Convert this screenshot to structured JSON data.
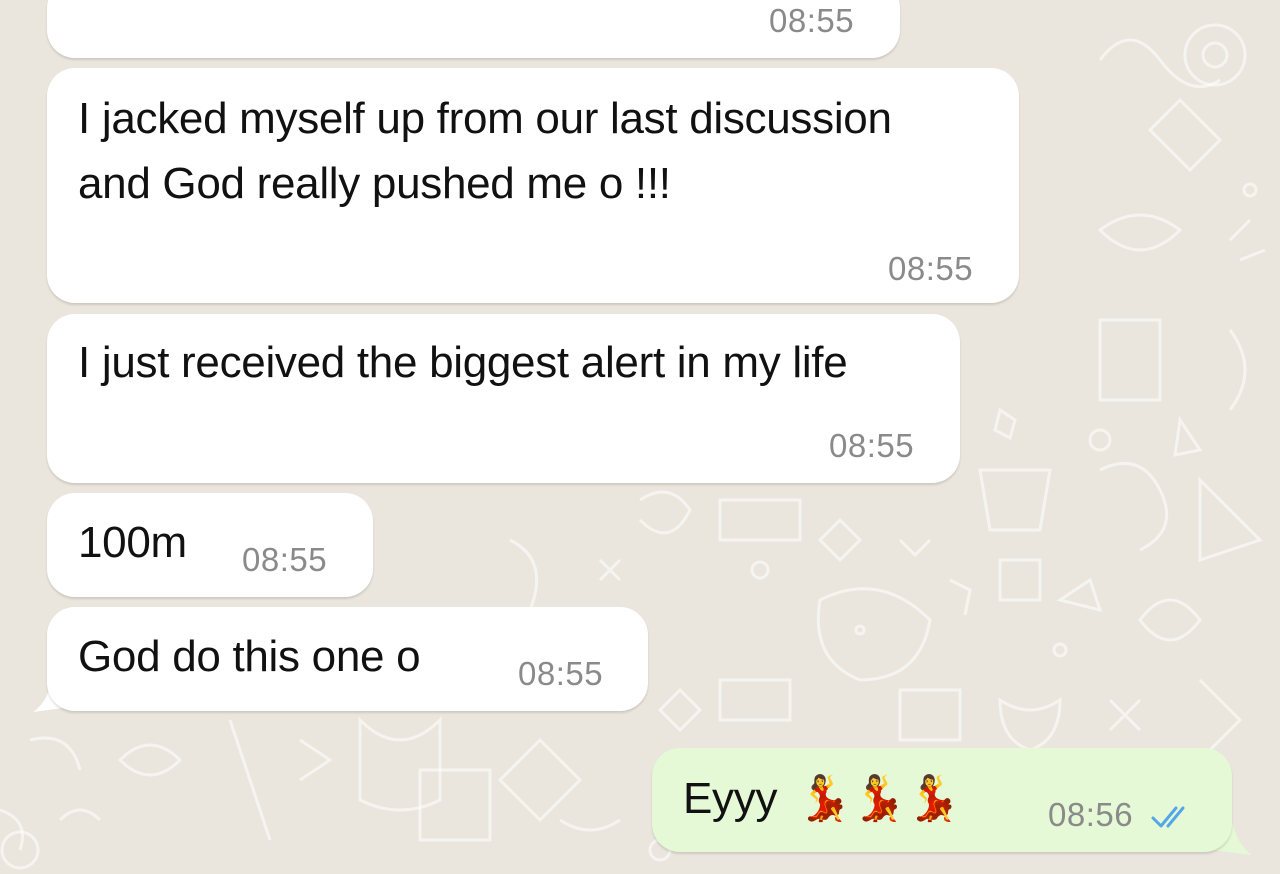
{
  "chat": {
    "messages": [
      {
        "direction": "incoming",
        "text": "",
        "time": "08:55"
      },
      {
        "direction": "incoming",
        "text": "I jacked myself up from our last discussion and God really pushed me o !!!",
        "time": "08:55"
      },
      {
        "direction": "incoming",
        "text": "I just received the biggest alert in my life",
        "time": "08:55"
      },
      {
        "direction": "incoming",
        "text": "100m",
        "time": "08:55"
      },
      {
        "direction": "incoming",
        "text": "God do this one o",
        "time": "08:55"
      },
      {
        "direction": "outgoing",
        "text": "Eyyy",
        "emoji": "💃💃💃",
        "time": "08:56",
        "status": "read"
      }
    ]
  },
  "colors": {
    "wallpaper": "#ebe6dd",
    "incoming_bubble": "#ffffff",
    "outgoing_bubble": "#e5f9d6",
    "read_ticks": "#53a6e8",
    "timestamp": "#8a8a8a"
  },
  "icons": {
    "read_status": "double-check-icon"
  }
}
